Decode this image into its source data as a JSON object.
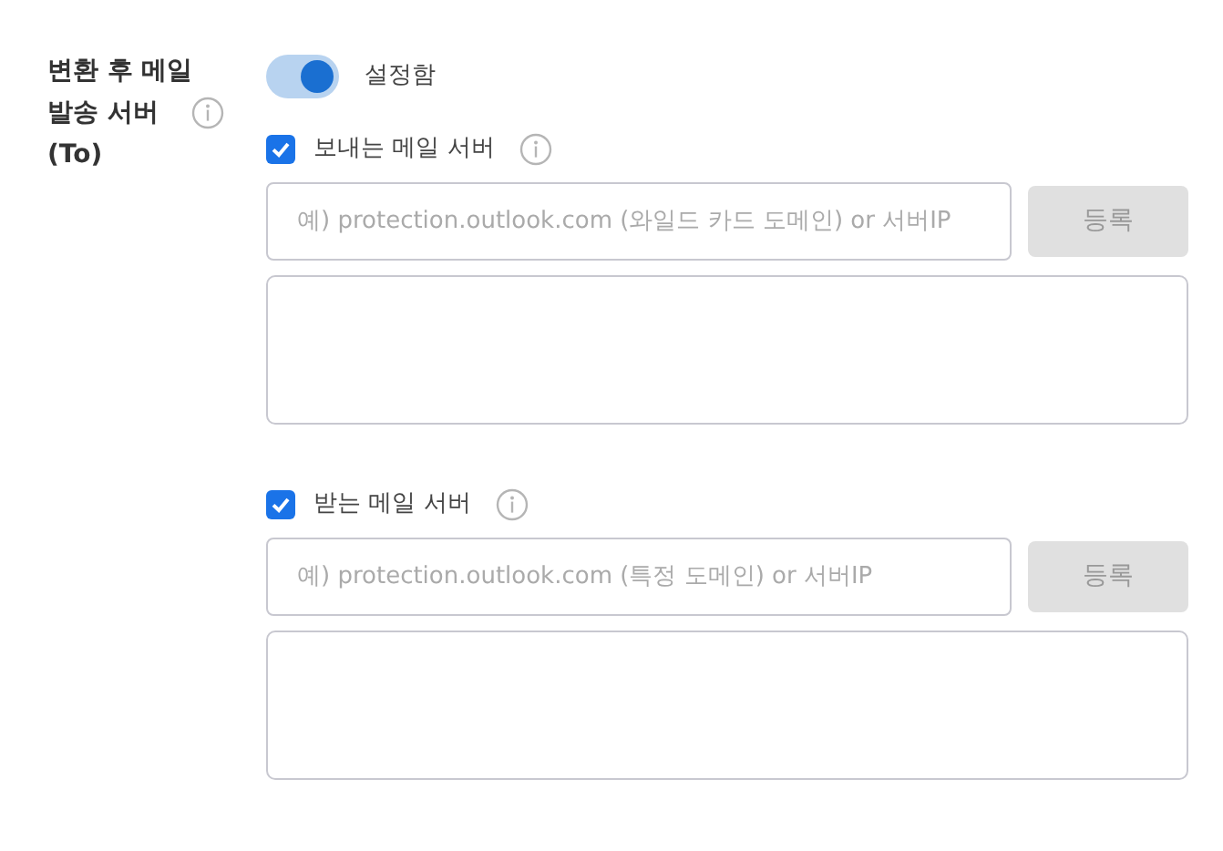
{
  "setting": {
    "label_lines": [
      "변환 후 메일",
      "발송 서버",
      "(To)"
    ],
    "toggle": {
      "on": true,
      "label": "설정함"
    },
    "sections": [
      {
        "checkbox": {
          "label": "보내는 메일 서버",
          "checked": true
        },
        "input": {
          "placeholder": "예) protection.outlook.com (와일드 카드 도메인) or 서버IP"
        },
        "button": {
          "label": "등록",
          "disabled": true
        }
      },
      {
        "checkbox": {
          "label": "받는 메일 서버",
          "checked": true
        },
        "input": {
          "placeholder": "예) protection.outlook.com (특정 도메인) or 서버IP"
        },
        "button": {
          "label": "등록",
          "disabled": true
        }
      }
    ]
  }
}
